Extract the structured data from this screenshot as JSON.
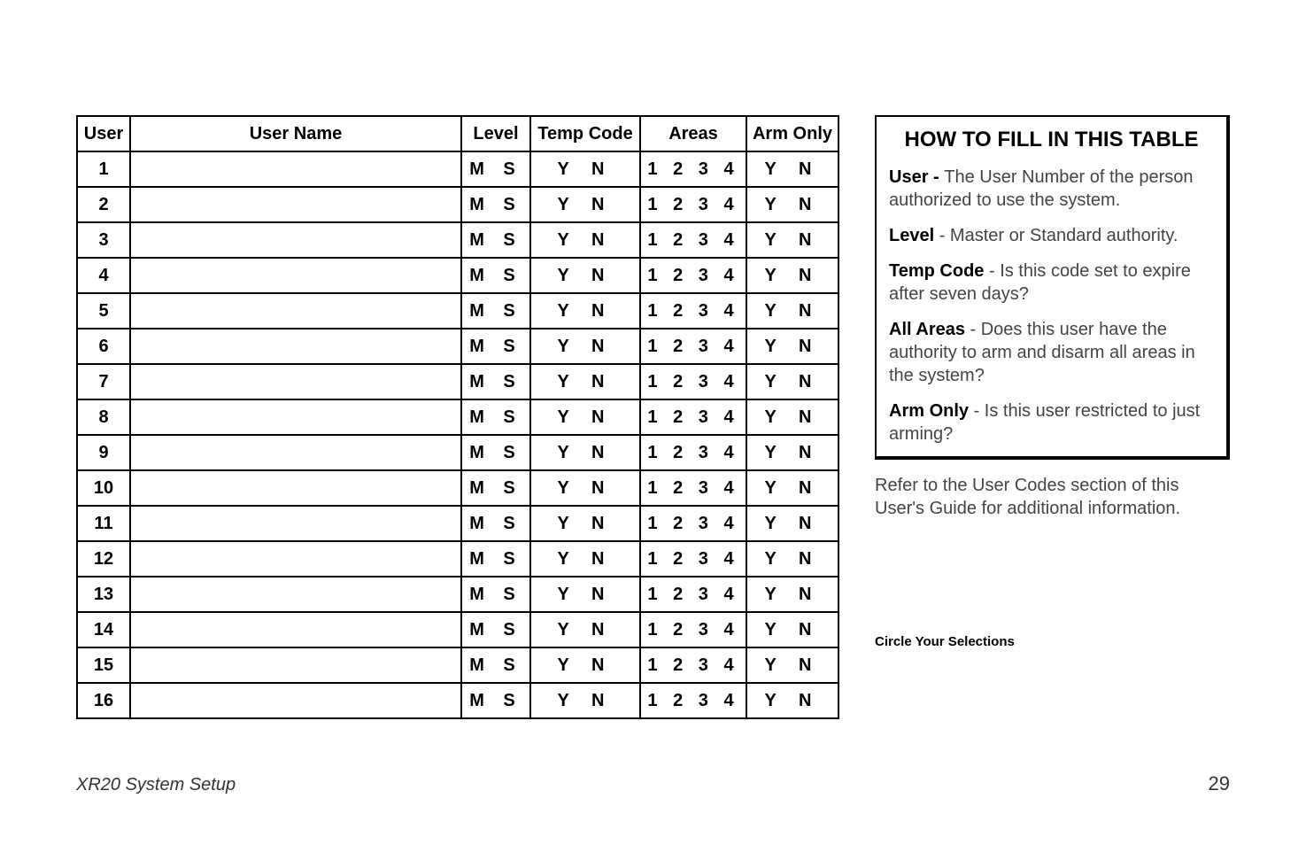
{
  "table": {
    "headers": {
      "user": "User",
      "name": "User Name",
      "level": "Level",
      "temp": "Temp Code",
      "areas": "Areas",
      "armonly": "Arm Only"
    },
    "level_opts": "M S",
    "yn_opts": "Y N",
    "areas_opts": "1 2 3 4",
    "row_numbers": [
      "1",
      "2",
      "3",
      "4",
      "5",
      "6",
      "7",
      "8",
      "9",
      "10",
      "11",
      "12",
      "13",
      "14",
      "15",
      "16"
    ]
  },
  "howto": {
    "title": "HOW TO FILL IN THIS TABLE",
    "user_label": "User - ",
    "user_text": "The User Number of the person authorized to use the system.",
    "level_label": "Level",
    "level_text": " - Master or Standard authority.",
    "temp_label": "Temp Code",
    "temp_text": " - Is this code set to expire after seven days?",
    "areas_label": "All Areas",
    "areas_text": " - Does this user have the authority to arm and disarm all areas in the system?",
    "arm_label": "Arm Only",
    "arm_text": " - Is this user restricted to just arming?"
  },
  "below_box": "Refer to the User Codes section of this User's Guide for additional information.",
  "circle_note": "Circle Your Selections",
  "footer": {
    "left": "XR20 System Setup",
    "page": "29"
  }
}
